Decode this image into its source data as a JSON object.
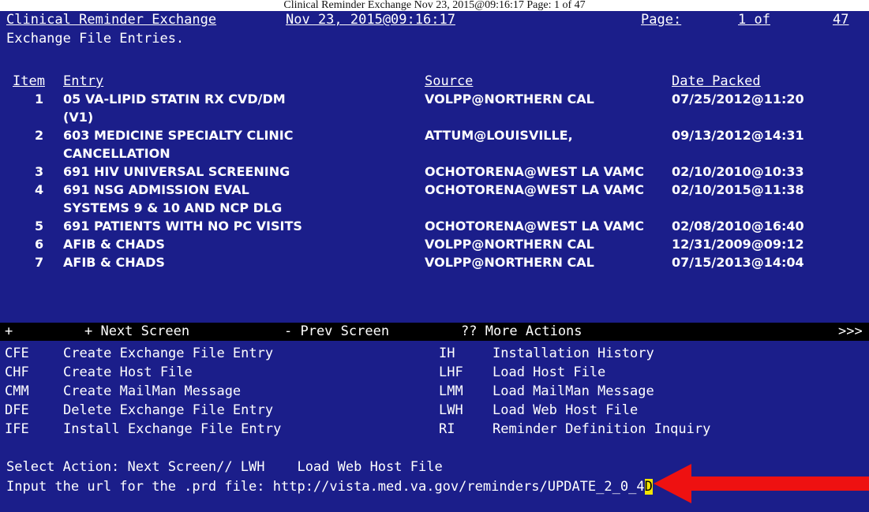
{
  "stamp": "Clinical Reminder Exchange   Nov 23, 2015@09:16:17   Page: 1 of 47",
  "header": {
    "title": "Clinical Reminder Exchange",
    "datetime": "Nov 23, 2015@09:16:17",
    "page_label": "Page:",
    "page_value": "1 of",
    "page_total": "47"
  },
  "subtitle": "Exchange File Entries.",
  "columns": {
    "item": "Item",
    "entry": "Entry",
    "source": "Source",
    "date": "Date Packed"
  },
  "rows": [
    {
      "item": "1",
      "entry": "05 VA-LIPID STATIN RX CVD/DM",
      "source": "VOLPP@NORTHERN CAL",
      "date": "07/25/2012@11:20"
    },
    {
      "item": "",
      "entry": "(V1)",
      "source": "",
      "date": ""
    },
    {
      "item": "2",
      "entry": "603 MEDICINE SPECIALTY CLINIC",
      "source": "ATTUM@LOUISVILLE,",
      "date": "09/13/2012@14:31"
    },
    {
      "item": "",
      "entry": "CANCELLATION",
      "source": "",
      "date": ""
    },
    {
      "item": "3",
      "entry": "691 HIV UNIVERSAL SCREENING",
      "source": "OCHOTORENA@WEST LA VAMC",
      "date": "02/10/2010@10:33"
    },
    {
      "item": "4",
      "entry": "691 NSG ADMISSION EVAL",
      "source": "OCHOTORENA@WEST LA VAMC",
      "date": "02/10/2015@11:38"
    },
    {
      "item": "",
      "entry": "SYSTEMS 9 & 10 AND NCP DLG",
      "source": "",
      "date": ""
    },
    {
      "item": "5",
      "entry": "691 PATIENTS WITH NO PC VISITS",
      "source": "OCHOTORENA@WEST LA VAMC",
      "date": "02/08/2010@16:40"
    },
    {
      "item": "6",
      "entry": "AFIB & CHADS",
      "source": "VOLPP@NORTHERN CAL",
      "date": "12/31/2009@09:12"
    },
    {
      "item": "7",
      "entry": "AFIB & CHADS",
      "source": "VOLPP@NORTHERN CAL",
      "date": "07/15/2013@14:04"
    }
  ],
  "nav": {
    "plus": "+",
    "next": "+ Next Screen",
    "prev": "- Prev Screen",
    "more": "?? More Actions",
    "more_indicator": ">>>"
  },
  "actions": [
    {
      "code": "CFE",
      "label": "Create Exchange File Entry",
      "code2": "IH",
      "label2": "Installation History"
    },
    {
      "code": "CHF",
      "label": "Create Host File",
      "code2": "LHF",
      "label2": "Load Host File"
    },
    {
      "code": "CMM",
      "label": "Create MailMan Message",
      "code2": "LMM",
      "label2": "Load MailMan Message"
    },
    {
      "code": "DFE",
      "label": "Delete Exchange File Entry",
      "code2": "LWH",
      "label2": "Load Web Host File"
    },
    {
      "code": "IFE",
      "label": "Install Exchange File Entry",
      "code2": "RI",
      "label2": "Reminder Definition Inquiry"
    }
  ],
  "prompt": {
    "select_action": "Select Action: Next Screen// LWH    Load Web Host File",
    "input_url": "Input the url for the .prd file: http://vista.med.va.gov/reminders/UPDATE_2_0_4",
    "cursor_char": "D"
  },
  "colors": {
    "background": "#1b1e8a",
    "text": "#ffffff",
    "cursor": "#f2e400",
    "arrow": "#ee1111"
  },
  "annotation": {
    "icon": "red-arrow-icon"
  }
}
